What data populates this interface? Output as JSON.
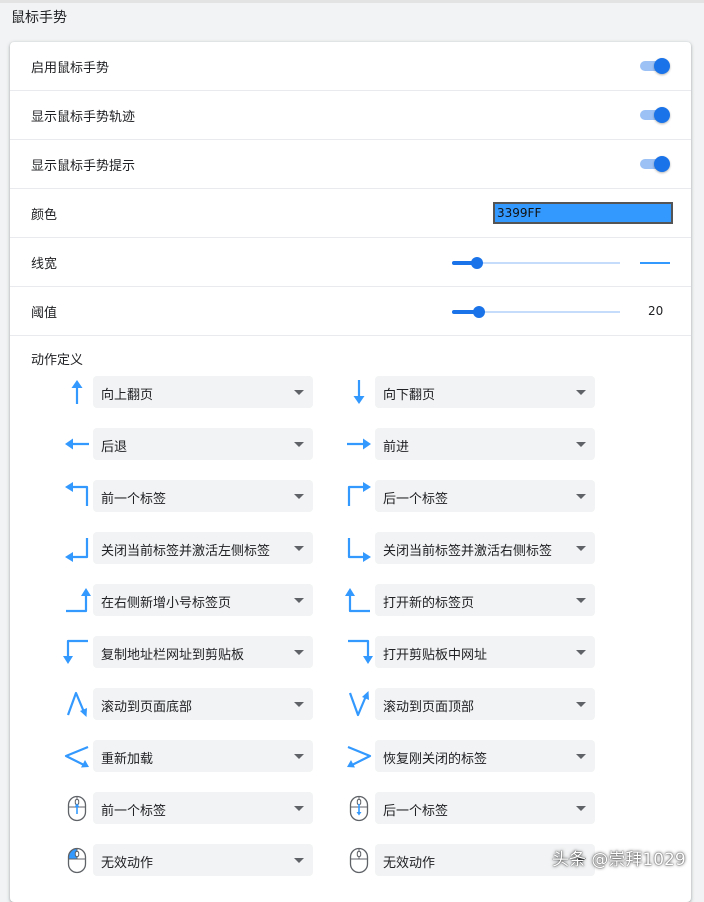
{
  "section_title": "鼠标手势",
  "settings": {
    "enable": {
      "label": "启用鼠标手势"
    },
    "show_trail": {
      "label": "显示鼠标手势轨迹"
    },
    "show_hint": {
      "label": "显示鼠标手势提示"
    },
    "color": {
      "label": "颜色",
      "value": "3399FF"
    },
    "line_width": {
      "label": "线宽",
      "level": 0.15
    },
    "threshold": {
      "label": "阈值",
      "value": "20",
      "level": 0.16
    }
  },
  "actions_title": "动作定义",
  "gestures": [
    {
      "icon": "arrow-up-icon",
      "action": "向上翻页"
    },
    {
      "icon": "arrow-down-icon",
      "action": "向下翻页"
    },
    {
      "icon": "arrow-left-icon",
      "action": "后退"
    },
    {
      "icon": "arrow-right-icon",
      "action": "前进"
    },
    {
      "icon": "up-left-icon",
      "action": "前一个标签"
    },
    {
      "icon": "up-right-icon",
      "action": "后一个标签"
    },
    {
      "icon": "down-left-icon",
      "action": "关闭当前标签并激活左侧标签"
    },
    {
      "icon": "down-right-icon",
      "action": "关闭当前标签并激活右侧标签"
    },
    {
      "icon": "right-up-icon",
      "action": "在右侧新增小号标签页"
    },
    {
      "icon": "left-up-icon",
      "action": "打开新的标签页"
    },
    {
      "icon": "left-down-icon",
      "action": "复制地址栏网址到剪贴板"
    },
    {
      "icon": "right-down-icon",
      "action": "打开剪贴板中网址"
    },
    {
      "icon": "up-down-icon",
      "action": "滚动到页面底部"
    },
    {
      "icon": "down-up-icon",
      "action": "滚动到页面顶部"
    },
    {
      "icon": "right-left-icon",
      "action": "重新加载"
    },
    {
      "icon": "left-right-icon",
      "action": "恢复刚关闭的标签"
    },
    {
      "icon": "mouse-wheel-up-icon",
      "action": "前一个标签"
    },
    {
      "icon": "mouse-wheel-down-icon",
      "action": "后一个标签"
    },
    {
      "icon": "mouse-left-button-icon",
      "action": "无效动作"
    },
    {
      "icon": "mouse-icon",
      "action": "无效动作"
    }
  ],
  "colors": {
    "accent": "#1a73e8",
    "gesture_arrow": "#3399ff"
  },
  "watermark": "头条 @崇拜1029"
}
